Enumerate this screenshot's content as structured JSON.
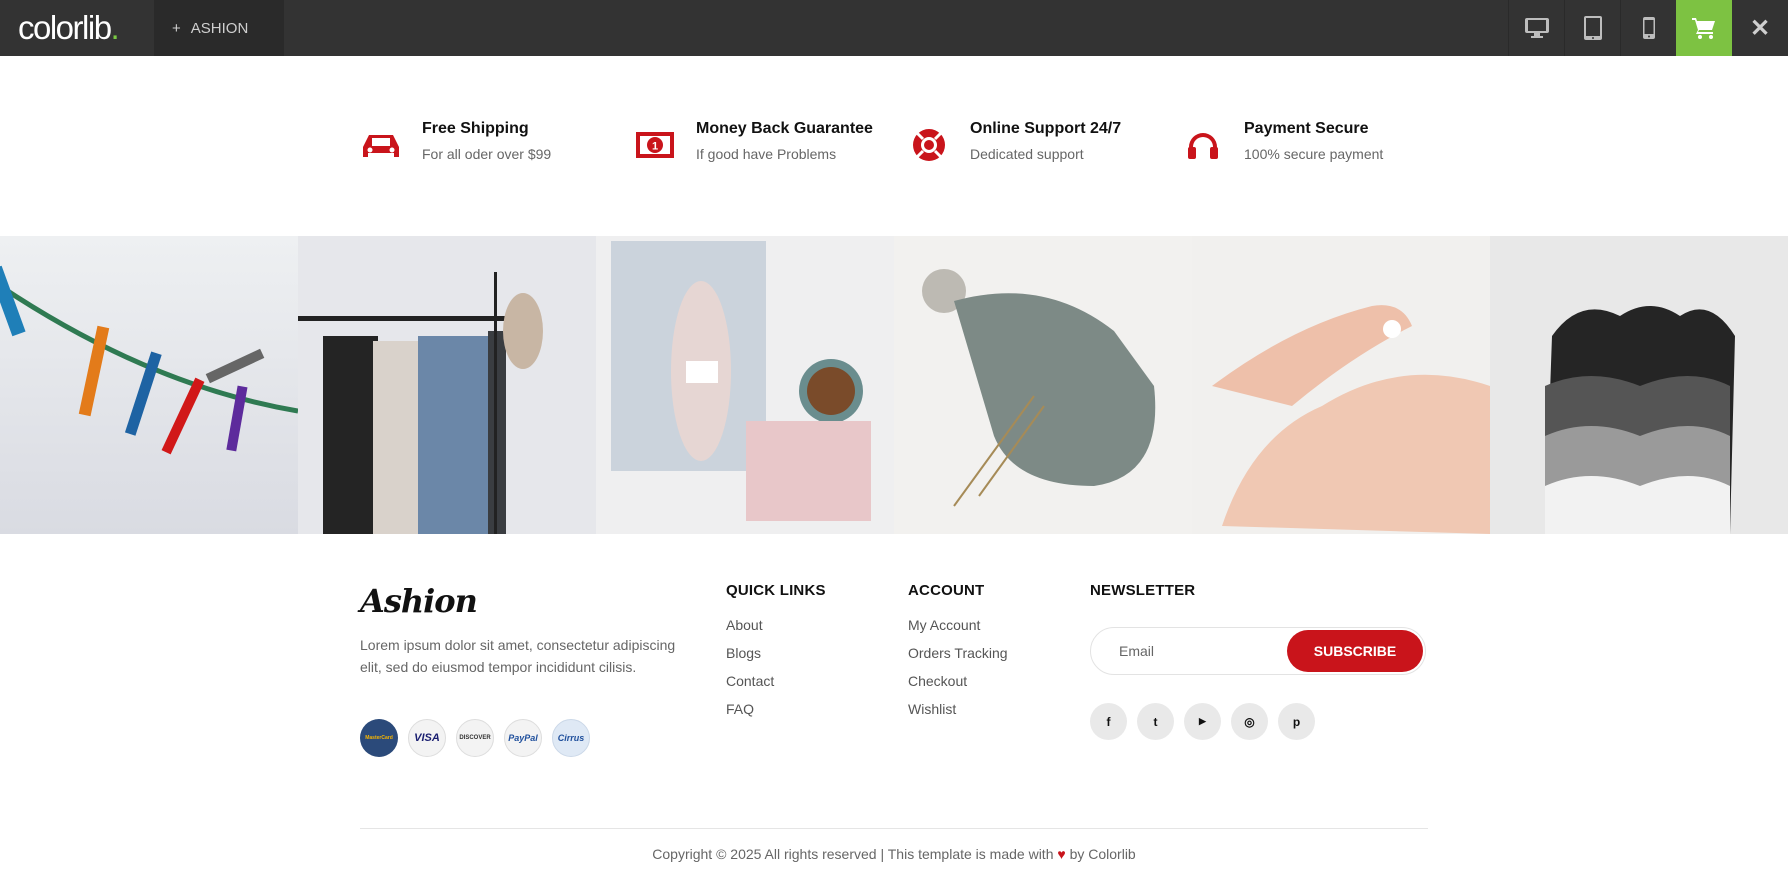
{
  "topbar": {
    "brand": "colorlib",
    "brand_dot": ".",
    "theme_plus": "+",
    "theme_name": "ASHION",
    "close_glyph": "✕"
  },
  "features": [
    {
      "title": "Free Shipping",
      "subtitle": "For all oder over $99",
      "icon": "car-icon"
    },
    {
      "title": "Money Back Guarantee",
      "subtitle": "If good have Problems",
      "icon": "money-icon"
    },
    {
      "title": "Online Support 24/7",
      "subtitle": "Dedicated support",
      "icon": "lifebuoy-icon"
    },
    {
      "title": "Payment Secure",
      "subtitle": "100% secure payment",
      "icon": "headset-icon"
    }
  ],
  "gallery": {
    "items": [
      "clothespins",
      "clothes-rack",
      "yarn-and-coffee",
      "knit-bonnet",
      "hand-lotion",
      "tank-tops"
    ]
  },
  "footer": {
    "logo": "Ashion",
    "about": "Lorem ipsum dolor sit amet, consectetur adipiscing elit, sed do eiusmod tempor incididunt cilisis.",
    "payments": [
      "MasterCard",
      "VISA",
      "DISCOVER",
      "PayPal",
      "Cirrus"
    ],
    "quick_links": {
      "title": "QUICK LINKS",
      "items": [
        "About",
        "Blogs",
        "Contact",
        "FAQ"
      ]
    },
    "account": {
      "title": "ACCOUNT",
      "items": [
        "My Account",
        "Orders Tracking",
        "Checkout",
        "Wishlist"
      ]
    },
    "newsletter": {
      "title": "NEWSLETTER",
      "placeholder": "Email",
      "button": "SUBSCRIBE"
    },
    "socials": [
      {
        "name": "facebook-icon",
        "glyph": "f"
      },
      {
        "name": "twitter-icon",
        "glyph": "t"
      },
      {
        "name": "youtube-icon",
        "glyph": "▶"
      },
      {
        "name": "instagram-icon",
        "glyph": "◎"
      },
      {
        "name": "pinterest-icon",
        "glyph": "p"
      }
    ],
    "copyright_pre": "Copyright © 2025 All rights reserved | This template is made with",
    "copyright_post": "by Colorlib"
  },
  "colors": {
    "accent": "#c9141b",
    "topbar": "#333333",
    "cart": "#7dc242"
  }
}
